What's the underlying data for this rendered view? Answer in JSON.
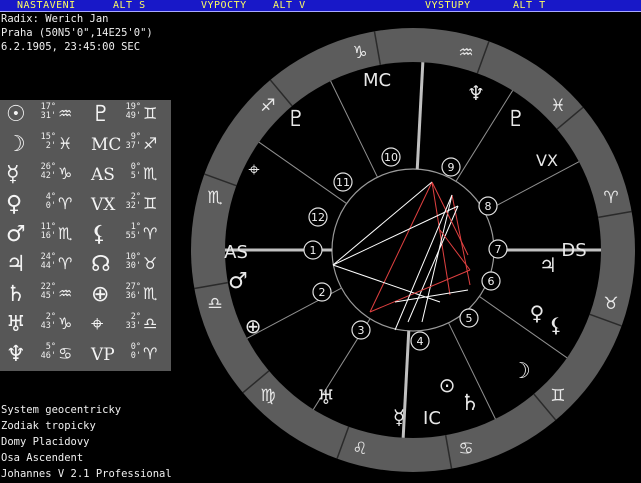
{
  "menu": {
    "items": [
      "NASTAVENI",
      "ALT S",
      "VYPOCTY",
      "ALT V",
      "VYSTUPY",
      "ALT T"
    ]
  },
  "header": {
    "name": "Radix: Werich Jan",
    "place": "Praha (50N5'0\",14E25'0\")",
    "datetime": "6.2.1905, 23:45:00 SEC"
  },
  "positions": [
    {
      "planet": "sun-icon",
      "glyph": "☉",
      "deg": "17°",
      "min": "31'",
      "sign": "♒"
    },
    {
      "planet": "moon-icon",
      "glyph": "☽",
      "deg": "15°",
      "min": "2'",
      "sign": "♓"
    },
    {
      "planet": "mercury-icon",
      "glyph": "☿",
      "deg": "26°",
      "min": "42'",
      "sign": "♑"
    },
    {
      "planet": "venus-icon",
      "glyph": "♀",
      "deg": "4°",
      "min": "0'",
      "sign": "♈"
    },
    {
      "planet": "mars-icon",
      "glyph": "♂",
      "deg": "11°",
      "min": "16'",
      "sign": "♏"
    },
    {
      "planet": "jupiter-icon",
      "glyph": "♃",
      "deg": "24°",
      "min": "44'",
      "sign": "♈"
    },
    {
      "planet": "saturn-icon",
      "glyph": "♄",
      "deg": "22°",
      "min": "45'",
      "sign": "♒"
    },
    {
      "planet": "uranus-icon",
      "glyph": "♅",
      "deg": "2°",
      "min": "43'",
      "sign": "♑"
    },
    {
      "planet": "neptune-icon",
      "glyph": "♆",
      "deg": "5°",
      "min": "46'",
      "sign": "♋"
    },
    {
      "planet": "pluto-icon",
      "glyph": "♇",
      "deg": "19°",
      "min": "49'",
      "sign": "♊"
    },
    {
      "planet": "mc-icon",
      "glyph": "MC",
      "deg": "9°",
      "min": "37'",
      "sign": "♐"
    },
    {
      "planet": "asc-icon",
      "glyph": "AS",
      "deg": "0°",
      "min": "5'",
      "sign": "♏"
    },
    {
      "planet": "vertex-icon",
      "glyph": "VX",
      "deg": "2°",
      "min": "32'",
      "sign": "♊"
    },
    {
      "planet": "lilith-icon",
      "glyph": "⚸",
      "deg": "1°",
      "min": "55'",
      "sign": "♈"
    },
    {
      "planet": "node-icon",
      "glyph": "☊",
      "deg": "10°",
      "min": "30'",
      "sign": "♉"
    },
    {
      "planet": "fortune-icon",
      "glyph": "⊕",
      "deg": "27°",
      "min": "36'",
      "sign": "♏"
    },
    {
      "planet": "east-point-icon",
      "glyph": "⌖",
      "deg": "2°",
      "min": "33'",
      "sign": "♎"
    },
    {
      "planet": "vp-icon",
      "glyph": "VP",
      "deg": "0°",
      "min": "0'",
      "sign": "♈"
    }
  ],
  "status": {
    "system": "System geocentricky",
    "zodiac": "Zodiak tropicky",
    "houses": "Domy Placidovy",
    "axis": "Osa Ascendent",
    "version": "Johannes V 2.1 Professional"
  },
  "chart": {
    "axis_labels": {
      "asc": "AS",
      "dsc": "DS",
      "mc": "MC",
      "ic": "IC"
    },
    "houses": [
      "1",
      "2",
      "3",
      "4",
      "5",
      "6",
      "7",
      "8",
      "9",
      "10",
      "11",
      "12"
    ],
    "colors": {
      "ring": "#5c5c5c",
      "aspect_red": "#e04040",
      "aspect_white": "#ffffff",
      "line": "#a0a0a0"
    }
  }
}
